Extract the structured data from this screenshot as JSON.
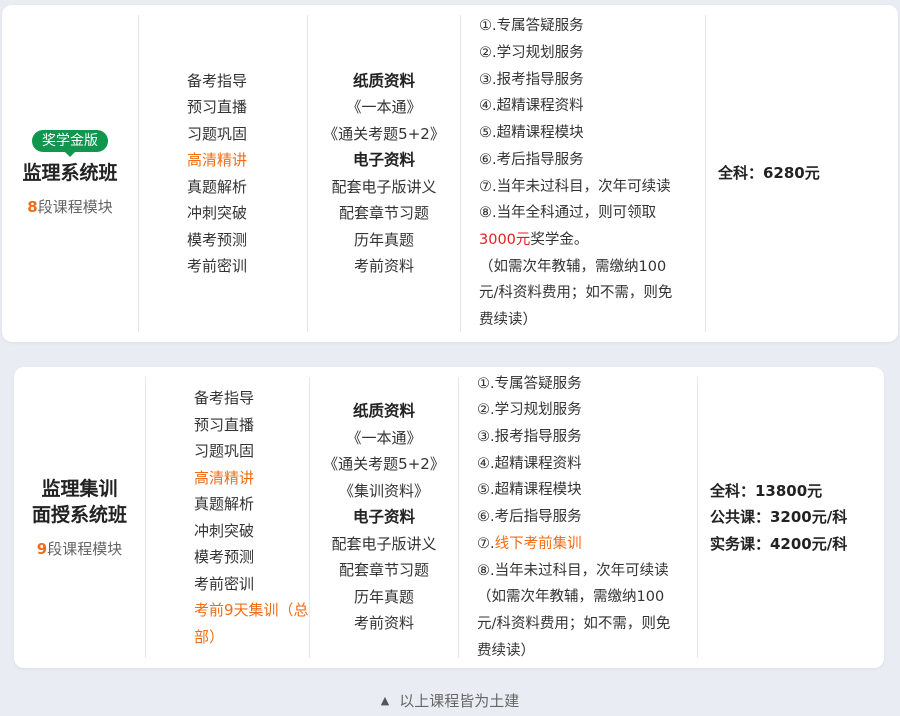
{
  "course1": {
    "badge": "奖学金版",
    "title_lines": [
      "监理系统班"
    ],
    "modules_num": "8",
    "modules_text": "段课程模块",
    "lessons": [
      {
        "text": "备考指导",
        "highlight": false
      },
      {
        "text": "预习直播",
        "highlight": false
      },
      {
        "text": "习题巩固",
        "highlight": false
      },
      {
        "text": "高清精讲",
        "highlight": true
      },
      {
        "text": "真题解析",
        "highlight": false
      },
      {
        "text": "冲刺突破",
        "highlight": false
      },
      {
        "text": "模考预测",
        "highlight": false
      },
      {
        "text": "考前密训",
        "highlight": false
      }
    ],
    "materials": [
      {
        "text": "纸质资料",
        "head": true
      },
      {
        "text": "《一本通》",
        "head": false
      },
      {
        "text": "《通关考题5+2》",
        "head": false
      },
      {
        "text": "电子资料",
        "head": true
      },
      {
        "text": "配套电子版讲义",
        "head": false
      },
      {
        "text": "配套章节习题",
        "head": false
      },
      {
        "text": "历年真题",
        "head": false
      },
      {
        "text": "考前资料",
        "head": false
      }
    ],
    "services": [
      [
        {
          "t": "①.专属答疑服务"
        }
      ],
      [
        {
          "t": "②.学习规划服务"
        }
      ],
      [
        {
          "t": "③.报考指导服务"
        }
      ],
      [
        {
          "t": "④.超精课程资料"
        }
      ],
      [
        {
          "t": "⑤.超精课程模块"
        }
      ],
      [
        {
          "t": "⑥.考后指导服务"
        }
      ],
      [
        {
          "t": "⑦.当年未过科目，次年可续读"
        }
      ],
      [
        {
          "t": "⑧.当年全科通过，则可领取"
        }
      ],
      [
        {
          "t": "3000元",
          "c": "red"
        },
        {
          "t": "奖学金。"
        }
      ],
      [
        {
          "t": "（如需次年教辅，需缴纳100"
        }
      ],
      [
        {
          "t": "元/科资料费用；如不需，则免"
        }
      ],
      [
        {
          "t": "费续读）"
        }
      ]
    ],
    "prices": [
      "全科：6280元"
    ]
  },
  "course2": {
    "title_lines": [
      "监理集训",
      "面授系统班"
    ],
    "modules_num": "9",
    "modules_text": "段课程模块",
    "lessons": [
      {
        "text": "备考指导",
        "highlight": false
      },
      {
        "text": "预习直播",
        "highlight": false
      },
      {
        "text": "习题巩固",
        "highlight": false
      },
      {
        "text": "高清精讲",
        "highlight": true
      },
      {
        "text": "真题解析",
        "highlight": false
      },
      {
        "text": "冲刺突破",
        "highlight": false
      },
      {
        "text": "模考预测",
        "highlight": false
      },
      {
        "text": "考前密训",
        "highlight": false
      },
      {
        "text": "考前9天集训（总部）",
        "highlight": true
      }
    ],
    "materials": [
      {
        "text": "纸质资料",
        "head": true
      },
      {
        "text": "《一本通》",
        "head": false
      },
      {
        "text": "《通关考题5+2》",
        "head": false
      },
      {
        "text": "《集训资料》",
        "head": false
      },
      {
        "text": "电子资料",
        "head": true
      },
      {
        "text": "配套电子版讲义",
        "head": false
      },
      {
        "text": "配套章节习题",
        "head": false
      },
      {
        "text": "历年真题",
        "head": false
      },
      {
        "text": "考前资料",
        "head": false
      }
    ],
    "services": [
      [
        {
          "t": "①.专属答疑服务"
        }
      ],
      [
        {
          "t": "②.学习规划服务"
        }
      ],
      [
        {
          "t": "③.报考指导服务"
        }
      ],
      [
        {
          "t": "④.超精课程资料"
        }
      ],
      [
        {
          "t": "⑤.超精课程模块"
        }
      ],
      [
        {
          "t": "⑥.考后指导服务"
        }
      ],
      [
        {
          "t": "⑦."
        },
        {
          "t": "线下考前集训",
          "c": "org"
        }
      ],
      [
        {
          "t": "⑧.当年未过科目，次年可续读"
        }
      ],
      [
        {
          "t": "（如需次年教辅，需缴纳100"
        }
      ],
      [
        {
          "t": "元/科资料费用；如不需，则免"
        }
      ],
      [
        {
          "t": "费续读）"
        }
      ]
    ],
    "prices": [
      "全科：13800元",
      "公共课：3200元/科",
      "实务课：4200元/科"
    ]
  },
  "footer": {
    "text": "以上课程皆为土建",
    "icon": "triangle-up-icon"
  },
  "colors": {
    "accent": "#f06d18",
    "badge": "#11964e",
    "red": "#e02020"
  }
}
